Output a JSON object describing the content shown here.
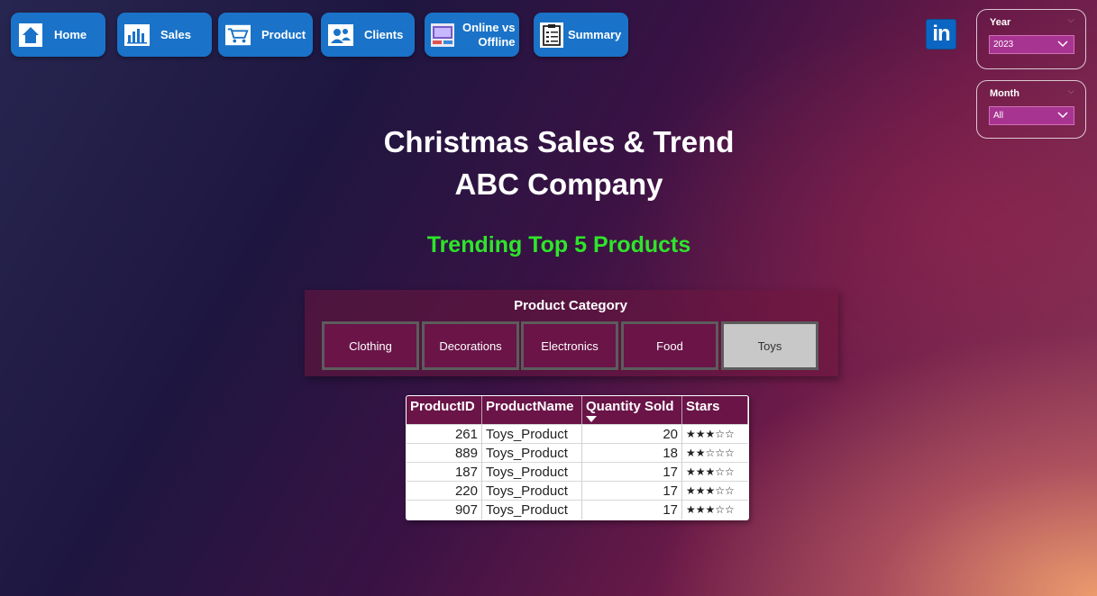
{
  "nav": {
    "home": "Home",
    "sales": "Sales",
    "product": "Product",
    "clients": "Clients",
    "online_line1": "Online vs",
    "online_line2": "Offline",
    "summary": "Summary"
  },
  "slicers": {
    "year": {
      "title": "Year",
      "value": "2023"
    },
    "month": {
      "title": "Month",
      "value": "All"
    }
  },
  "linkedin_label": "in",
  "header": {
    "title_line1": "Christmas Sales & Trend",
    "title_line2": "ABC Company",
    "subtitle": "Trending Top 5 Products"
  },
  "category": {
    "title": "Product Category",
    "items": [
      "Clothing",
      "Decorations",
      "Electronics",
      "Food",
      "Toys"
    ],
    "selected": "Toys"
  },
  "table": {
    "columns": [
      "ProductID",
      "ProductName",
      "Quantity Sold",
      "Stars"
    ],
    "sort_column": "Quantity Sold",
    "rows": [
      {
        "id": "261",
        "name": "Toys_Product",
        "qty": "20",
        "stars": "★★★☆☆"
      },
      {
        "id": "889",
        "name": "Toys_Product",
        "qty": "18",
        "stars": "★★☆☆☆"
      },
      {
        "id": "187",
        "name": "Toys_Product",
        "qty": "17",
        "stars": "★★★☆☆"
      },
      {
        "id": "220",
        "name": "Toys_Product",
        "qty": "17",
        "stars": "★★★☆☆"
      },
      {
        "id": "907",
        "name": "Toys_Product",
        "qty": "17",
        "stars": "★★★☆☆"
      }
    ]
  },
  "colors": {
    "nav_button": "#1a73c8",
    "accent_green": "#2ee52a",
    "category_button": "#6a1448",
    "category_selected": "#c8c8c8",
    "table_header": "#6a1448",
    "slicer_dropdown": "#a83491"
  }
}
